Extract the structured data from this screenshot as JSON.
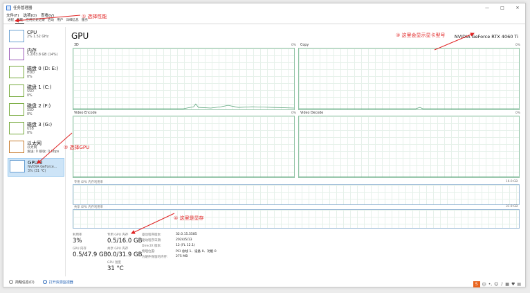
{
  "window": {
    "title": "任务管理器",
    "controls": {
      "minimize": "—",
      "maximize": "□",
      "close": "✕"
    }
  },
  "menu": [
    "文件(F)",
    "选项(O)",
    "查看(V)"
  ],
  "tabs": [
    "进程",
    "性能",
    "应用历史记录",
    "启动",
    "用户",
    "详细信息",
    "服务"
  ],
  "active_tab": "性能",
  "sidebar": {
    "items": [
      {
        "name": "CPU",
        "sub": [
          "2% 1.52 GHz"
        ],
        "kind": "cpu"
      },
      {
        "name": "内存",
        "sub": [
          "5.2/63.8 GB (14%)"
        ],
        "kind": "mem"
      },
      {
        "name": "磁盘 0 (D: E:)",
        "sub": [
          "HDD",
          "0%"
        ],
        "kind": "disk"
      },
      {
        "name": "磁盘 1 (C:)",
        "sub": [
          "SSD",
          "0%"
        ],
        "kind": "disk"
      },
      {
        "name": "磁盘 2 (F:)",
        "sub": [
          "SSD",
          "0%"
        ],
        "kind": "disk"
      },
      {
        "name": "磁盘 3 (G:)",
        "sub": [
          "USB",
          "0%"
        ],
        "kind": "disk"
      },
      {
        "name": "以太网",
        "sub": [
          "以太网",
          "发送: 0 接收: 0 Kbps"
        ],
        "kind": "net"
      },
      {
        "name": "GPU 0",
        "sub": [
          "NVIDIA GeForce...",
          "3% (31 °C)"
        ],
        "kind": "gpu",
        "active": true
      }
    ]
  },
  "main": {
    "title": "GPU",
    "model": "NVIDIA GeForce RTX 4060 Ti",
    "graphs": [
      {
        "label": "3D",
        "max": "0%"
      },
      {
        "label": "Copy",
        "max": "0%"
      },
      {
        "label": "Video Encode",
        "max": "0%"
      },
      {
        "label": "Video Decode",
        "max": "0%"
      }
    ],
    "dedicated_mem": {
      "label": "专用 GPU 内存利用率",
      "max": "16.0 GB"
    },
    "shared_mem": {
      "label": "共享 GPU 内存利用率",
      "max": "31.9 GB"
    },
    "stats": {
      "util_label": "利用率",
      "util_value": "3%",
      "ded_label": "专用 GPU 内存",
      "ded_value": "0.5/16.0 GB",
      "gpumem_label": "GPU 内存",
      "gpumem_value": "0.5/47.9 GB",
      "shared_label": "共享 GPU 内存",
      "shared_value": "0.0/31.9 GB",
      "temp_label": "GPU 温度",
      "temp_value": "31 °C"
    },
    "info": [
      {
        "label": "驱动程序版本:",
        "value": "32.0.15.5585"
      },
      {
        "label": "驱动程序日期:",
        "value": "2024/5/13"
      },
      {
        "label": "DirectX 版本:",
        "value": "12 (FL 12.1)"
      },
      {
        "label": "物理位置:",
        "value": "PCI 总线 1、设备 0、功能 0"
      },
      {
        "label": "为硬件保留的内存:",
        "value": "275 MB"
      }
    ]
  },
  "footer": {
    "less": "简略信息(D)",
    "resmon": "打开资源监视器"
  },
  "annotations": {
    "a1": "① 选择性能",
    "a2": "② 选择GPU",
    "a3": "③ 这里会显示显卡型号",
    "a4": "④ 这里是显存"
  },
  "tray": {
    "s": "S",
    "lang": "中"
  },
  "colors": {
    "accent": "#9ccbef",
    "annotation": "#e02222",
    "graph_line": "#8fc3a4"
  }
}
